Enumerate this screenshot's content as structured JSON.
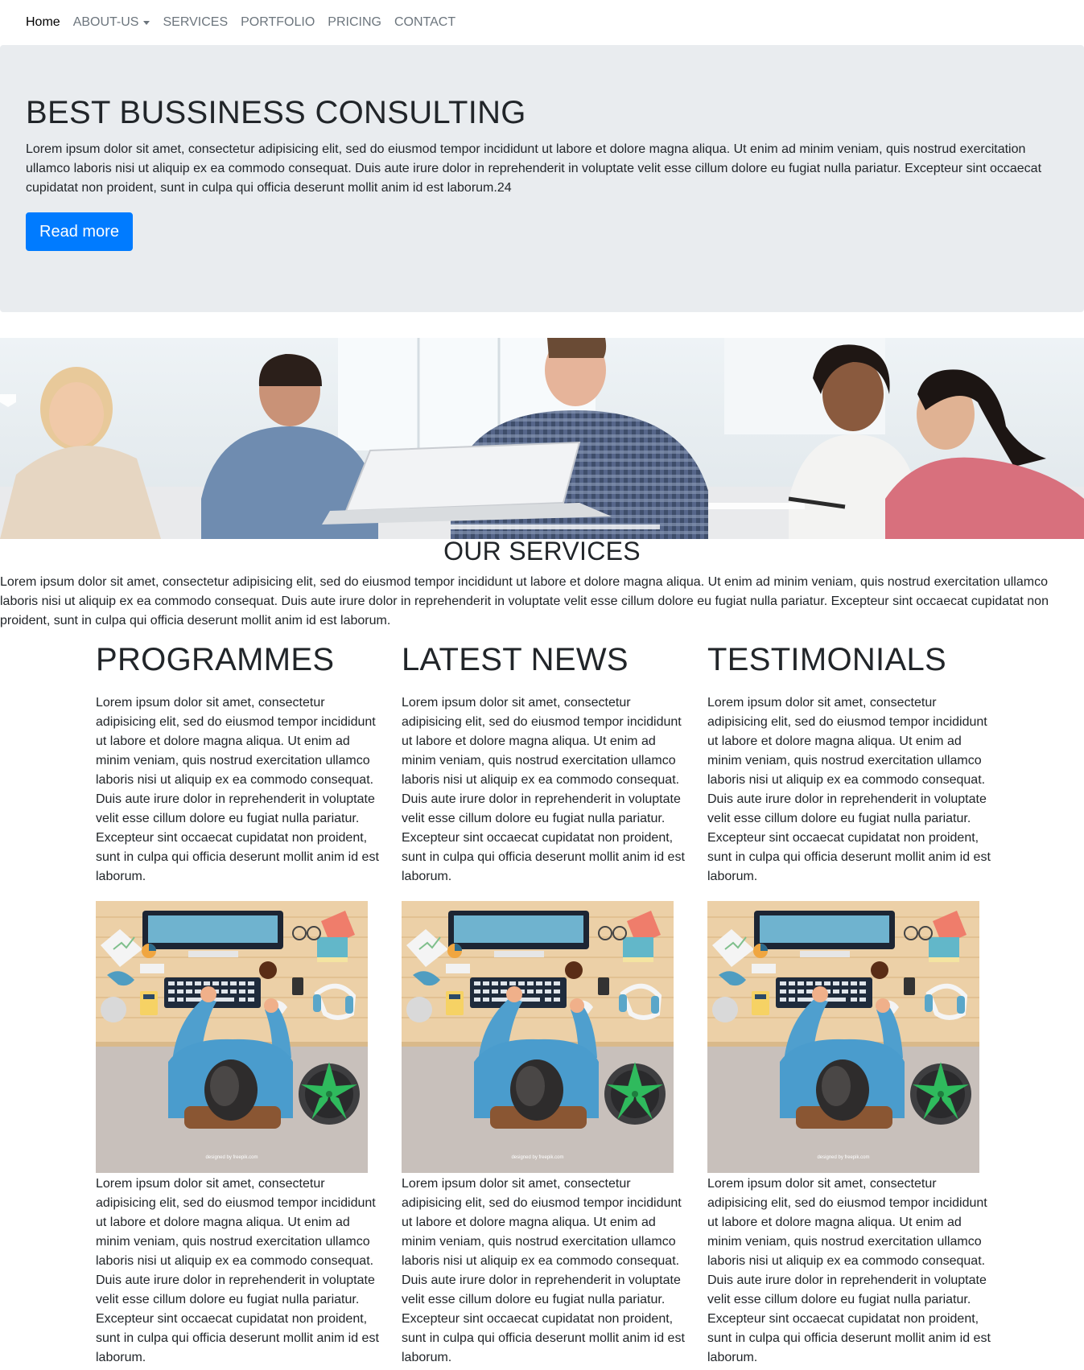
{
  "nav": {
    "items": [
      {
        "label": "Home",
        "active": true
      },
      {
        "label": "ABOUT-US",
        "dropdown": true
      },
      {
        "label": "SERVICES"
      },
      {
        "label": "PORTFOLIO"
      },
      {
        "label": "PRICING"
      },
      {
        "label": "CONTACT"
      }
    ]
  },
  "hero": {
    "title": "BEST BUSSINESS CONSULTING",
    "text": "Lorem ipsum dolor sit amet, consectetur adipisicing elit, sed do eiusmod tempor incididunt ut labore et dolore magna aliqua. Ut enim ad minim veniam, quis nostrud exercitation ullamco laboris nisi ut aliquip ex ea commodo consequat. Duis aute irure dolor in reprehenderit in voluptate velit esse cillum dolore eu fugiat nulla pariatur. Excepteur sint occaecat cupidatat non proident, sunt in culpa qui officia deserunt mollit anim id est laborum.24",
    "button_label": "Read more",
    "button_color": "#007bff"
  },
  "banner": {
    "image": "business-team-meeting-photo"
  },
  "services": {
    "title": "OUR SERVICES",
    "text": "Lorem ipsum dolor sit amet, consectetur adipisicing elit, sed do eiusmod tempor incididunt ut labore et dolore magna aliqua. Ut enim ad minim veniam, quis nostrud exercitation ullamco laboris nisi ut aliquip ex ea commodo consequat. Duis aute irure dolor in reprehenderit in voluptate velit esse cillum dolore eu fugiat nulla pariatur. Excepteur sint occaecat cupidatat non proident, sunt in culpa qui officia deserunt mollit anim id est laborum."
  },
  "columns": [
    {
      "title": "PROGRAMMES",
      "text_top": "Lorem ipsum dolor sit amet, consectetur adipisicing elit, sed do eiusmod tempor incididunt ut labore et dolore magna aliqua. Ut enim ad minim veniam, quis nostrud exercitation ullamco laboris nisi ut aliquip ex ea commodo consequat. Duis aute irure dolor in reprehenderit in voluptate velit esse cillum dolore eu fugiat nulla pariatur. Excepteur sint occaecat cupidatat non proident, sunt in culpa qui officia deserunt mollit anim id est laborum.",
      "image_credit": "designed by freepik.com",
      "text_bottom": "Lorem ipsum dolor sit amet, consectetur adipisicing elit, sed do eiusmod tempor incididunt ut labore et dolore magna aliqua. Ut enim ad minim veniam, quis nostrud exercitation ullamco laboris nisi ut aliquip ex ea commodo consequat. Duis aute irure dolor in reprehenderit in voluptate velit esse cillum dolore eu fugiat nulla pariatur. Excepteur sint occaecat cupidatat non proident, sunt in culpa qui officia deserunt mollit anim id est laborum."
    },
    {
      "title": "LATEST NEWS",
      "text_top": "Lorem ipsum dolor sit amet, consectetur adipisicing elit, sed do eiusmod tempor incididunt ut labore et dolore magna aliqua. Ut enim ad minim veniam, quis nostrud exercitation ullamco laboris nisi ut aliquip ex ea commodo consequat. Duis aute irure dolor in reprehenderit in voluptate velit esse cillum dolore eu fugiat nulla pariatur. Excepteur sint occaecat cupidatat non proident, sunt in culpa qui officia deserunt mollit anim id est laborum.",
      "image_credit": "designed by freepik.com",
      "text_bottom": "Lorem ipsum dolor sit amet, consectetur adipisicing elit, sed do eiusmod tempor incididunt ut labore et dolore magna aliqua. Ut enim ad minim veniam, quis nostrud exercitation ullamco laboris nisi ut aliquip ex ea commodo consequat. Duis aute irure dolor in reprehenderit in voluptate velit esse cillum dolore eu fugiat nulla pariatur. Excepteur sint occaecat cupidatat non proident, sunt in culpa qui officia deserunt mollit anim id est laborum."
    },
    {
      "title": "TESTIMONIALS",
      "text_top": "Lorem ipsum dolor sit amet, consectetur adipisicing elit, sed do eiusmod tempor incididunt ut labore et dolore magna aliqua. Ut enim ad minim veniam, quis nostrud exercitation ullamco laboris nisi ut aliquip ex ea commodo consequat. Duis aute irure dolor in reprehenderit in voluptate velit esse cillum dolore eu fugiat nulla pariatur. Excepteur sint occaecat cupidatat non proident, sunt in culpa qui officia deserunt mollit anim id est laborum.",
      "image_credit": "designed by freepik.com",
      "text_bottom": "Lorem ipsum dolor sit amet, consectetur adipisicing elit, sed do eiusmod tempor incididunt ut labore et dolore magna aliqua. Ut enim ad minim veniam, quis nostrud exercitation ullamco laboris nisi ut aliquip ex ea commodo consequat. Duis aute irure dolor in reprehenderit in voluptate velit esse cillum dolore eu fugiat nulla pariatur. Excepteur sint occaecat cupidatat non proident, sunt in culpa qui officia deserunt mollit anim id est laborum."
    }
  ]
}
